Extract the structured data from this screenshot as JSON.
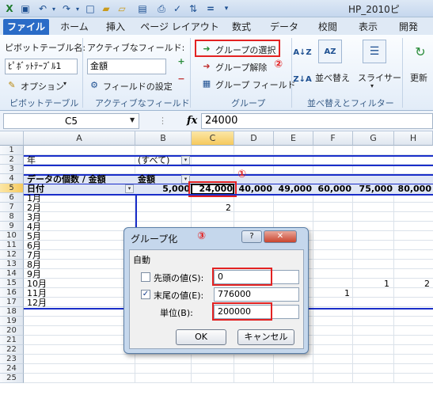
{
  "window": {
    "title": "HP_2010ピ",
    "quick_access": [
      "save-icon",
      "undo-icon",
      "redo-icon",
      "new-icon",
      "open-icon",
      "folder-icon",
      "print-preview-icon",
      "spellcheck-icon",
      "equals-icon",
      "qat-menu-icon"
    ]
  },
  "tabs": [
    {
      "label": "ファイル"
    },
    {
      "label": "ホーム"
    },
    {
      "label": "挿入"
    },
    {
      "label": "ページ レイアウト"
    },
    {
      "label": "数式"
    },
    {
      "label": "データ"
    },
    {
      "label": "校閲"
    },
    {
      "label": "表示"
    },
    {
      "label": "開発"
    }
  ],
  "ribbon": {
    "pivot_name_label": "ピボットテーブル名:",
    "pivot_name_value": "ﾋﾟﾎﾞｯﾄﾃｰﾌﾞﾙ1",
    "options_label": "オプション",
    "group_pivot": "ピボットテーブル",
    "active_field_label": "アクティブなフィールド:",
    "active_field_value": "金額",
    "field_settings_label": "フィールドの設定",
    "group_active": "アクティブなフィールド",
    "group_selection_label": "グループの選択",
    "ungroup_label": "グループ解除",
    "group_field_label": "グループ フィールド",
    "group_group": "グループ",
    "sort_label": "並べ替え",
    "slicer_label": "スライサー",
    "group_sort": "並べ替えとフィルター",
    "refresh_label": "更新",
    "marker_2": "②"
  },
  "formula_bar": {
    "name_box": "C5",
    "fx": "fx",
    "value": "24000"
  },
  "grid": {
    "columns": [
      "A",
      "B",
      "C",
      "D",
      "E",
      "F",
      "G",
      "H"
    ],
    "rows": [
      "1",
      "2",
      "3",
      "4",
      "5",
      "6",
      "7",
      "8",
      "9",
      "10",
      "11",
      "12",
      "13",
      "14",
      "15",
      "16",
      "17",
      "18",
      "19",
      "20",
      "21",
      "22",
      "23",
      "24",
      "25"
    ],
    "a2": "年",
    "b2": "(すべて)",
    "a4": "データの個数 / 金額",
    "b4": "金額",
    "a5": "日付",
    "row5_values": [
      "5,000",
      "24,000",
      "40,000",
      "49,000",
      "60,000",
      "75,000",
      "80,000"
    ],
    "months": [
      "1月",
      "2月",
      "3月",
      "4月",
      "5月",
      "6月",
      "7月",
      "8月",
      "9月",
      "10月",
      "11月",
      "12月"
    ],
    "c7": "2",
    "g15": "1",
    "h15": "2",
    "f16": "1",
    "marker_1": "①"
  },
  "dialog": {
    "title": "グループ化",
    "marker_3": "③",
    "help_label": "?",
    "close_label": "✕",
    "section": "自動",
    "start_label": "先頭の値(S):",
    "start_checked": false,
    "start_value": "0",
    "end_label": "末尾の値(E):",
    "end_checked": true,
    "end_value": "776000",
    "unit_label": "単位(B):",
    "unit_value": "200000",
    "ok_label": "OK",
    "cancel_label": "キャンセル"
  }
}
